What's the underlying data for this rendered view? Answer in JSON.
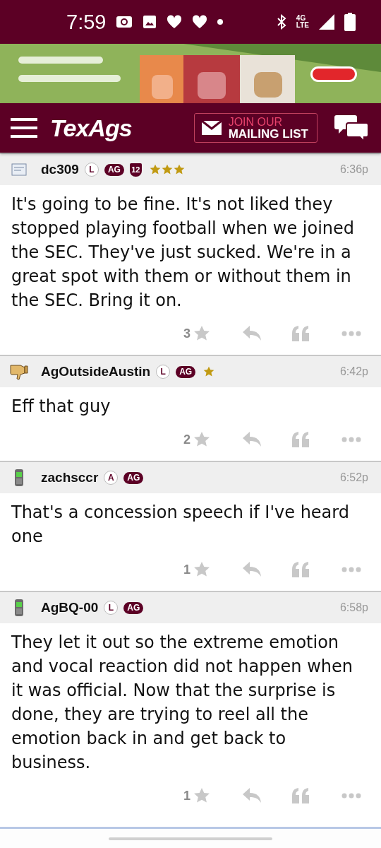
{
  "status_bar": {
    "time": "7:59",
    "network": [
      "4G",
      "LTE"
    ]
  },
  "header": {
    "logo": "TexAgs",
    "mailing_top": "JOIN OUR",
    "mailing_bottom": "MAILING LIST"
  },
  "posts": [
    {
      "avatar": {
        "kind": "note"
      },
      "username": "dc309",
      "badges": [
        {
          "kind": "outline",
          "text": "L"
        },
        {
          "kind": "filled",
          "text": "AG"
        },
        {
          "kind": "shield",
          "text": "12"
        }
      ],
      "stars": 3,
      "time": "6:36p",
      "body": "It's going to be fine. It's not liked they stopped playing football when we joined the SEC. They've just sucked. We're in a great spot with them or without them in the SEC. Bring it on.",
      "likes": "3"
    },
    {
      "avatar": {
        "kind": "thumbs"
      },
      "username": "AgOutsideAustin",
      "badges": [
        {
          "kind": "outline",
          "text": "L"
        },
        {
          "kind": "filled",
          "text": "AG"
        },
        {
          "kind": "star"
        }
      ],
      "time": "6:42p",
      "body": "Eff that guy",
      "likes": "2"
    },
    {
      "avatar": {
        "kind": "phone"
      },
      "username": "zachsccr",
      "badges": [
        {
          "kind": "outline",
          "text": "A"
        },
        {
          "kind": "filled",
          "text": "AG"
        }
      ],
      "time": "6:52p",
      "body": "That's a concession speech if I've heard one",
      "likes": "1"
    },
    {
      "avatar": {
        "kind": "phone"
      },
      "username": "AgBQ-00",
      "badges": [
        {
          "kind": "outline",
          "text": "L"
        },
        {
          "kind": "filled",
          "text": "AG"
        }
      ],
      "time": "6:58p",
      "body": "They let it out so the extreme emotion and vocal reaction did not happen when it was official. Now that the surprise is done, they are trying to reel all the emotion back in and get back to business.",
      "likes": "1"
    }
  ]
}
